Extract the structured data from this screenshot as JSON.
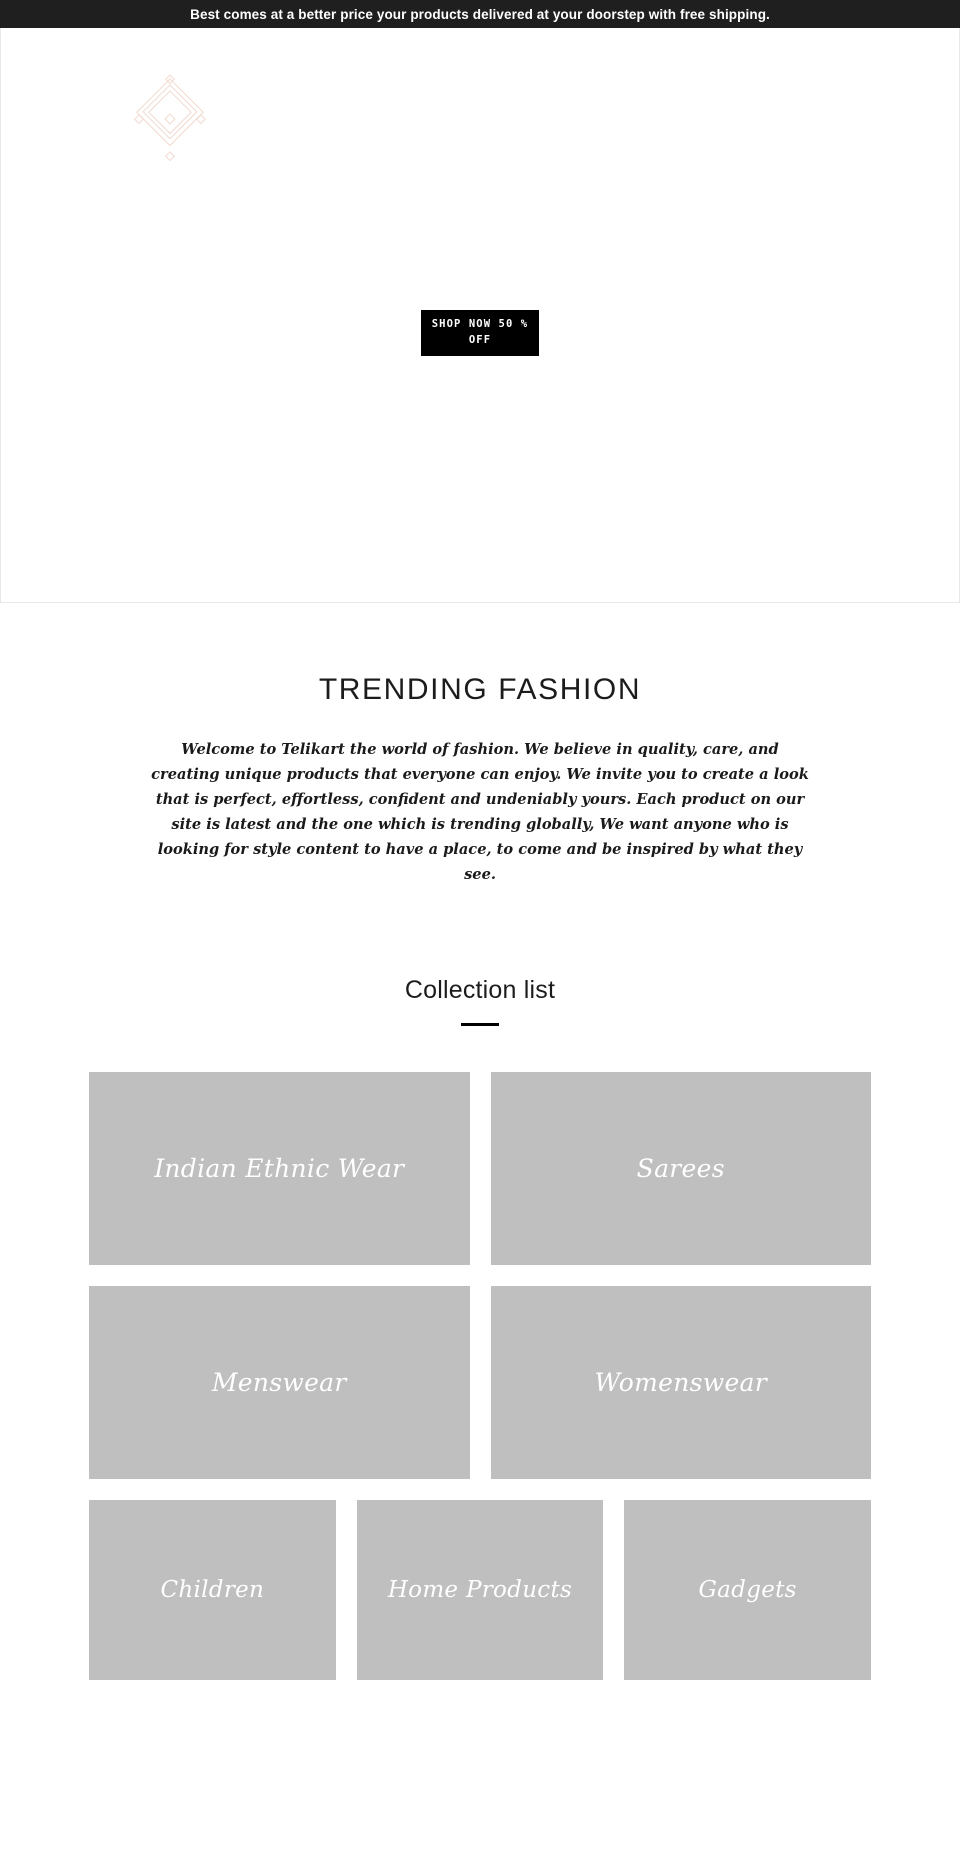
{
  "announcement": {
    "text": "Best comes at a better price your products delivered at your doorstep with free shipping.",
    "background": "#1f1f1f",
    "color": "#ffffff"
  },
  "hero": {
    "logo_icon": "diamond-geometric-logo",
    "logo_color": "#f2dcd3",
    "cta_label": "SHOP NOW 50 % OFF",
    "cta_background": "#000000",
    "cta_color": "#ffffff"
  },
  "trending": {
    "title": "TRENDING FASHION",
    "body": "Welcome to Telikart the world of fashion. We believe in quality, care, and creating unique products that everyone can enjoy. We invite you to create a look that is perfect, effortless, confident and undeniably yours. Each product on our site is latest and the one which is trending globally, We want anyone who is looking for style content to have a place, to come and be inspired by what they see."
  },
  "collection": {
    "title": "Collection list",
    "divider_color": "#000000",
    "card_background": "#bfbfbf",
    "card_label_color": "#ffffff",
    "rows": [
      {
        "columns": 2,
        "cards": [
          {
            "label": "Indian Ethnic Wear"
          },
          {
            "label": "Sarees"
          }
        ]
      },
      {
        "columns": 2,
        "cards": [
          {
            "label": "Menswear"
          },
          {
            "label": "Womenswear"
          }
        ]
      },
      {
        "columns": 3,
        "cards": [
          {
            "label": "Children"
          },
          {
            "label": "Home Products"
          },
          {
            "label": "Gadgets"
          }
        ]
      }
    ]
  }
}
